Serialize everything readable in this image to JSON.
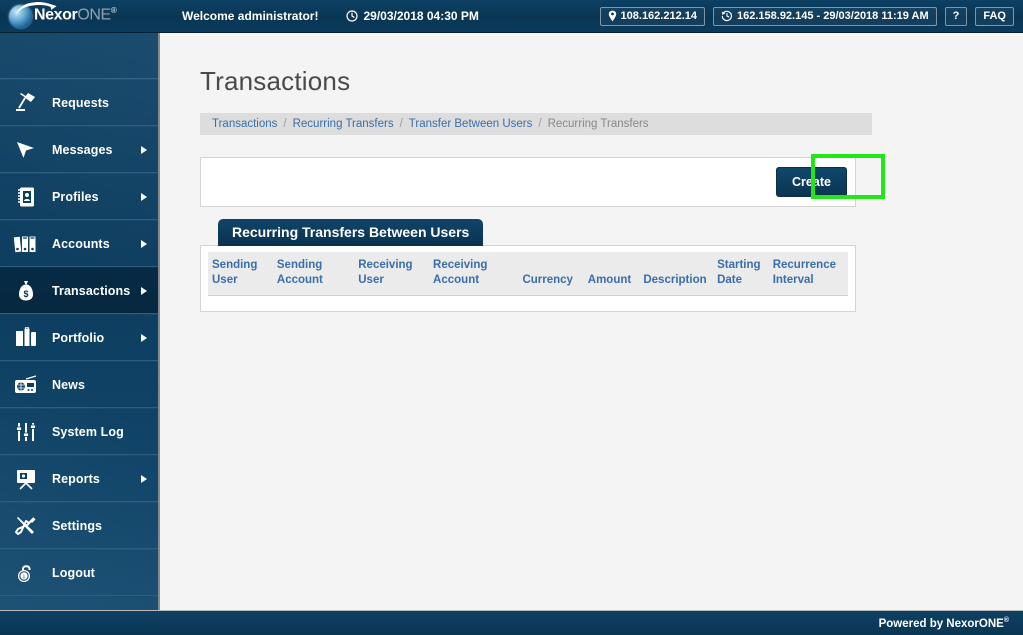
{
  "topbar": {
    "logo": {
      "primary": "Nexor",
      "secondary": "ONE",
      "registered": "®"
    },
    "welcome": "Welcome administrator!",
    "datetime": "29/03/2018 04:30 PM",
    "clock_icon": "clock-icon",
    "ip_pill": {
      "icon": "location-pin-icon",
      "text": "108.162.212.14"
    },
    "last_login_pill": {
      "icon": "history-clock-icon",
      "text": "162.158.92.145 - 29/03/2018 11:19 AM"
    },
    "help_button": "?",
    "faq_button": "FAQ"
  },
  "sidebar": {
    "items": [
      {
        "label": "Requests",
        "icon": "desk-lamp-icon",
        "arrow": false,
        "active": false
      },
      {
        "label": "Messages",
        "icon": "cursor-arrow-icon",
        "arrow": true,
        "active": false
      },
      {
        "label": "Profiles",
        "icon": "address-book-icon",
        "arrow": true,
        "active": false
      },
      {
        "label": "Accounts",
        "icon": "binders-icon",
        "arrow": true,
        "active": false
      },
      {
        "label": "Transactions",
        "icon": "money-bag-icon",
        "arrow": true,
        "active": true
      },
      {
        "label": "Portfolio",
        "icon": "briefcase-icon",
        "arrow": true,
        "active": false
      },
      {
        "label": "News",
        "icon": "radio-icon",
        "arrow": false,
        "active": false
      },
      {
        "label": "System Log",
        "icon": "sliders-icon",
        "arrow": false,
        "active": false
      },
      {
        "label": "Reports",
        "icon": "presentation-icon",
        "arrow": true,
        "active": false
      },
      {
        "label": "Settings",
        "icon": "tools-icon",
        "arrow": false,
        "active": false
      },
      {
        "label": "Logout",
        "icon": "padlock-open-icon",
        "arrow": false,
        "active": false
      }
    ]
  },
  "main": {
    "page_title": "Transactions",
    "breadcrumb": [
      {
        "label": "Transactions",
        "link": true
      },
      {
        "label": "Recurring Transfers",
        "link": true
      },
      {
        "label": "Transfer Between Users",
        "link": true
      },
      {
        "label": "Recurring Transfers",
        "link": false
      }
    ],
    "breadcrumb_separator": "/",
    "create_button": "Create",
    "highlight_color": "#22e617",
    "tab_label": "Recurring Transfers Between Users",
    "table": {
      "columns": [
        "Sending User",
        "Sending Account",
        "Receiving User",
        "Receiving Account",
        "Currency",
        "Amount",
        "Description",
        "Starting Date",
        "Recurrence Interval"
      ],
      "rows": []
    }
  },
  "footer": {
    "text": "Powered by NexorONE",
    "registered": "®"
  }
}
